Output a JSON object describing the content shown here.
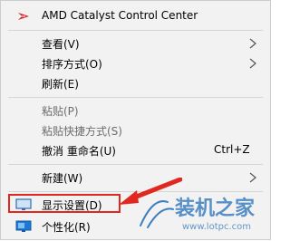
{
  "menu": {
    "items": [
      {
        "label": "AMD Catalyst Control Center",
        "icon": "amd-logo-icon"
      },
      {
        "label": "查看(V)",
        "submenu": true
      },
      {
        "label": "排序方式(O)",
        "submenu": true
      },
      {
        "label": "刷新(E)"
      },
      {
        "label": "粘贴(P)",
        "disabled": true
      },
      {
        "label": "粘贴快捷方式(S)",
        "disabled": true
      },
      {
        "label": "撤消 重命名(U)",
        "shortcut": "Ctrl+Z"
      },
      {
        "label": "新建(W)",
        "submenu": true
      },
      {
        "label": "显示设置(D)",
        "icon": "display-settings-icon",
        "highlighted": true
      },
      {
        "label": "个性化(R)",
        "icon": "personalize-icon"
      }
    ]
  },
  "watermark": {
    "title": "装机之家",
    "url": "www.lotpc.com"
  },
  "colors": {
    "menu_bg": "#f2f2f2",
    "highlight_red": "#e0281e",
    "disabled_text": "#6d6d6d",
    "watermark_blue": "#3d7ec0"
  }
}
